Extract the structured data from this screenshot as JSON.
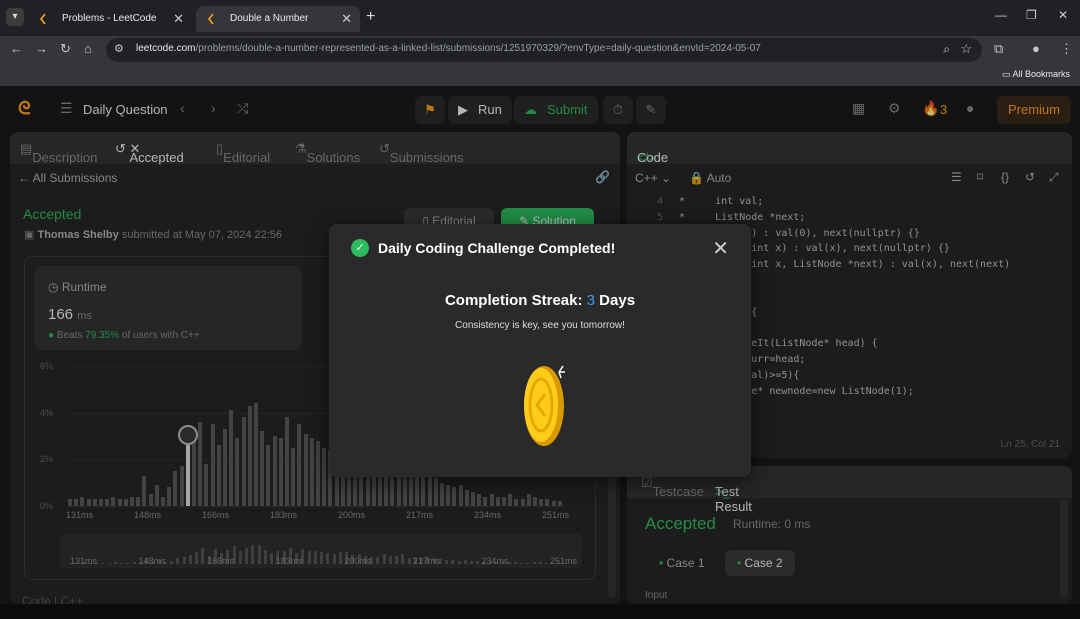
{
  "browser": {
    "tabs": [
      {
        "title": "Problems - LeetCode",
        "active": false
      },
      {
        "title": "Double a Number Represented",
        "active": true
      }
    ],
    "url_domain": "leetcode.com",
    "url_path": "/problems/double-a-number-represented-as-a-linked-list/submissions/1251970329/?envType=daily-question&envId=2024-05-07",
    "bookmarks_label": "All Bookmarks"
  },
  "header": {
    "list_title": "Daily Question",
    "run_label": "Run",
    "submit_label": "Submit",
    "streak_count": "3",
    "premium_label": "Premium"
  },
  "left_panel": {
    "tabs": [
      "Description",
      "Accepted",
      "Editorial",
      "Solutions",
      "Submissions"
    ],
    "back_label": "All Submissions",
    "status": "Accepted",
    "author": "Thomas Shelby",
    "submitted_text": "submitted at May 07, 2024 22:56",
    "editorial_btn": "Editorial",
    "solution_btn": "Solution",
    "runtime": {
      "label": "Runtime",
      "value": "166",
      "unit": "ms",
      "beats_prefix": "Beats",
      "beats_pct": "79.35%",
      "beats_suffix": "of users with C++"
    },
    "bottom_label": "Code   |   C++"
  },
  "chart_data": {
    "type": "bar",
    "y_ticks": [
      "6%",
      "4%",
      "2%",
      "0%"
    ],
    "x_ticks": [
      "131ms",
      "148ms",
      "166ms",
      "183ms",
      "200ms",
      "217ms",
      "234ms",
      "251ms"
    ],
    "ylim": [
      0,
      6
    ],
    "values": [
      0.3,
      0.3,
      0.4,
      0.3,
      0.3,
      0.3,
      0.3,
      0.4,
      0.3,
      0.3,
      0.4,
      0.4,
      1.3,
      0.5,
      0.9,
      0.4,
      0.8,
      1.5,
      1.7,
      2.1,
      2.8,
      3.6,
      1.8,
      3.5,
      2.6,
      3.3,
      4.1,
      2.9,
      3.8,
      4.3,
      4.4,
      3.2,
      2.6,
      3.0,
      2.9,
      3.8,
      2.5,
      3.5,
      3.1,
      2.9,
      2.8,
      2.5,
      2.4,
      2.8,
      2.7,
      2.1,
      2.3,
      1.8,
      1.7,
      1.6,
      2.4,
      1.8,
      1.9,
      2.2,
      1.4,
      1.5,
      1.4,
      1.6,
      1.3,
      1.2,
      1.0,
      0.9,
      0.8,
      0.9,
      0.7,
      0.6,
      0.5,
      0.4,
      0.5,
      0.4,
      0.4,
      0.5,
      0.3,
      0.3,
      0.5,
      0.4,
      0.3,
      0.3,
      0.2,
      0.2
    ],
    "highlight_index": 19,
    "highlight_value": 2.6
  },
  "code_panel": {
    "title": "Code",
    "language": "C++",
    "mode": "Auto",
    "lines": [
      {
        "n": "4",
        "t": " *     int val;"
      },
      {
        "n": "5",
        "t": " *     ListNode *next;"
      },
      {
        "n": "",
        "t": "         ode() : val(0), next(nullptr) {}"
      },
      {
        "n": "",
        "t": "         ode(int x) : val(x), next(nullptr) {}"
      },
      {
        "n": "",
        "t": "         ode(int x, ListNode *next) : val(x), next(next)"
      },
      {
        "n": "",
        "t": ""
      },
      {
        "n": "",
        "t": ""
      },
      {
        "n": "",
        "t": "         ion {"
      },
      {
        "n": "",
        "t": ""
      },
      {
        "n": "",
        "t": "      * doubleIt(ListNode* head) {"
      },
      {
        "n": "",
        "t": "      Node* curr=head;"
      },
      {
        "n": "",
        "t": "      head->val)>=5){"
      },
      {
        "n": "",
        "t": "      ListNode* newnode=new ListNode(1);"
      }
    ],
    "cursor": "Ln 25, Col 21"
  },
  "result_panel": {
    "tabs": [
      "Testcase",
      "Test Result"
    ],
    "status": "Accepted",
    "runtime": "Runtime: 0 ms",
    "cases": [
      "Case 1",
      "Case 2"
    ],
    "input_label": "Input"
  },
  "modal": {
    "title": "Daily Coding Challenge Completed!",
    "streak_prefix": "Completion Streak:",
    "streak_value": "3",
    "streak_suffix": "Days",
    "subtitle": "Consistency is key, see you tomorrow!"
  },
  "colors": {
    "accent_green": "#2cbb5d",
    "brand_orange": "#ffa116",
    "streak_blue": "#3d9bf5"
  }
}
